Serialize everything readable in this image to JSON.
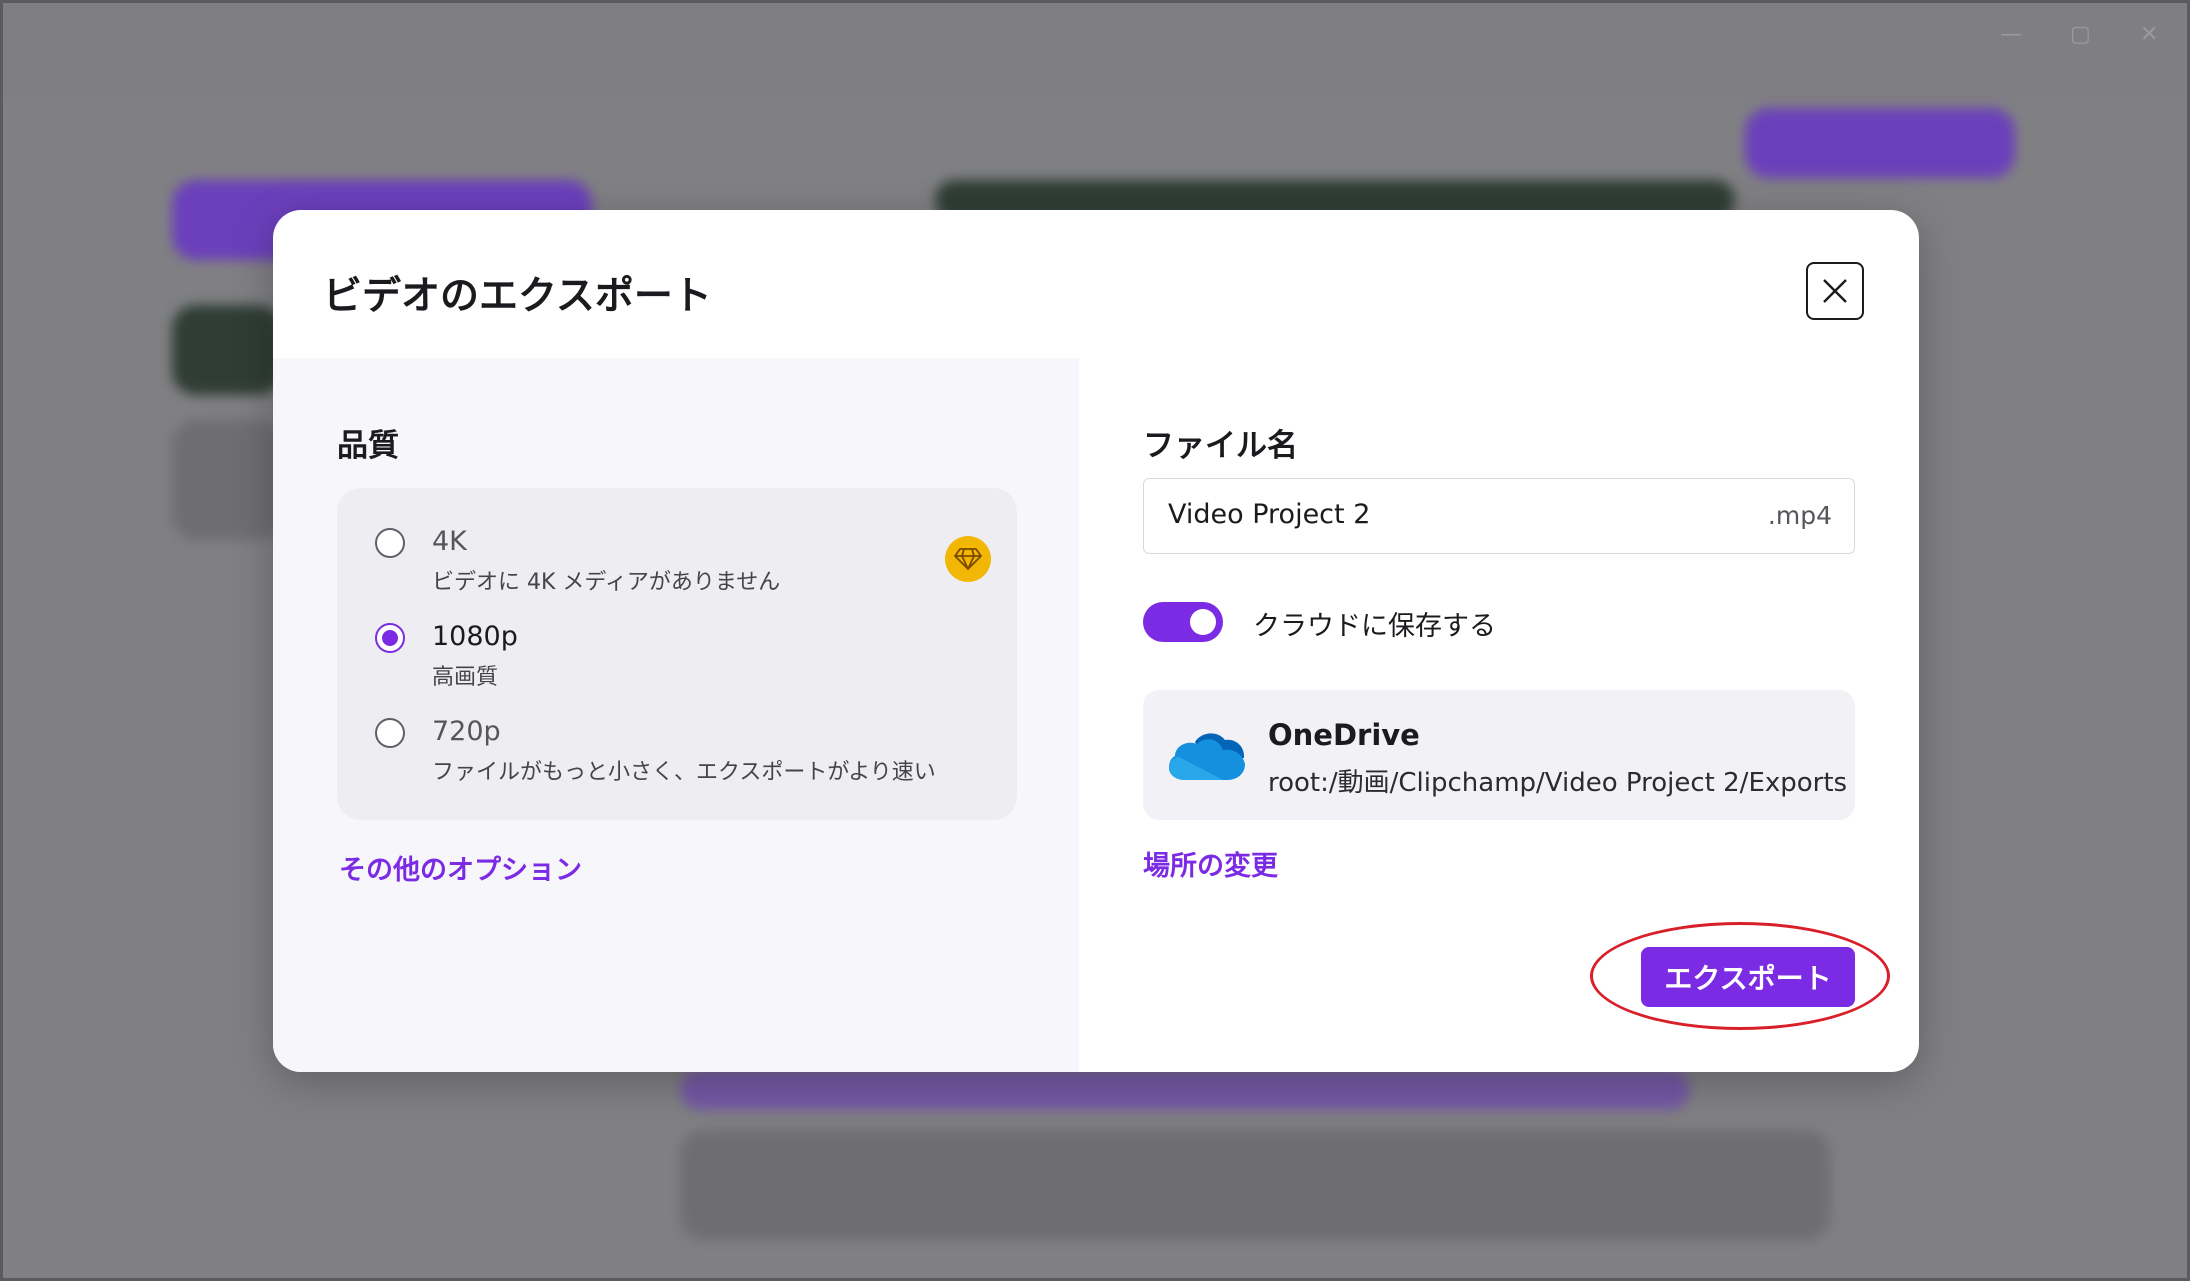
{
  "dialog": {
    "title": "ビデオのエクスポート"
  },
  "quality": {
    "label": "品質",
    "options": [
      {
        "title": "4K",
        "description": "ビデオに 4K メディアがありません",
        "selected": false,
        "premium": true
      },
      {
        "title": "1080p",
        "description": "高画質",
        "selected": true,
        "premium": false
      },
      {
        "title": "720p",
        "description": "ファイルがもっと小さく、エクスポートがより速い",
        "selected": false,
        "premium": false
      }
    ],
    "more_options_link": "その他のオプション"
  },
  "file": {
    "label": "ファイル名",
    "name_value": "Video Project 2",
    "extension": ".mp4"
  },
  "cloud_save": {
    "label": "クラウドに保存する",
    "enabled": true
  },
  "storage": {
    "provider": "OneDrive",
    "path": "root:/動画/Clipchamp/Video Project 2/Exports",
    "change_location_link": "場所の変更"
  },
  "actions": {
    "export_label": "エクスポート"
  },
  "colors": {
    "accent": "#7c2be4",
    "premium": "#f2b705",
    "highlight": "#d91f2a"
  }
}
